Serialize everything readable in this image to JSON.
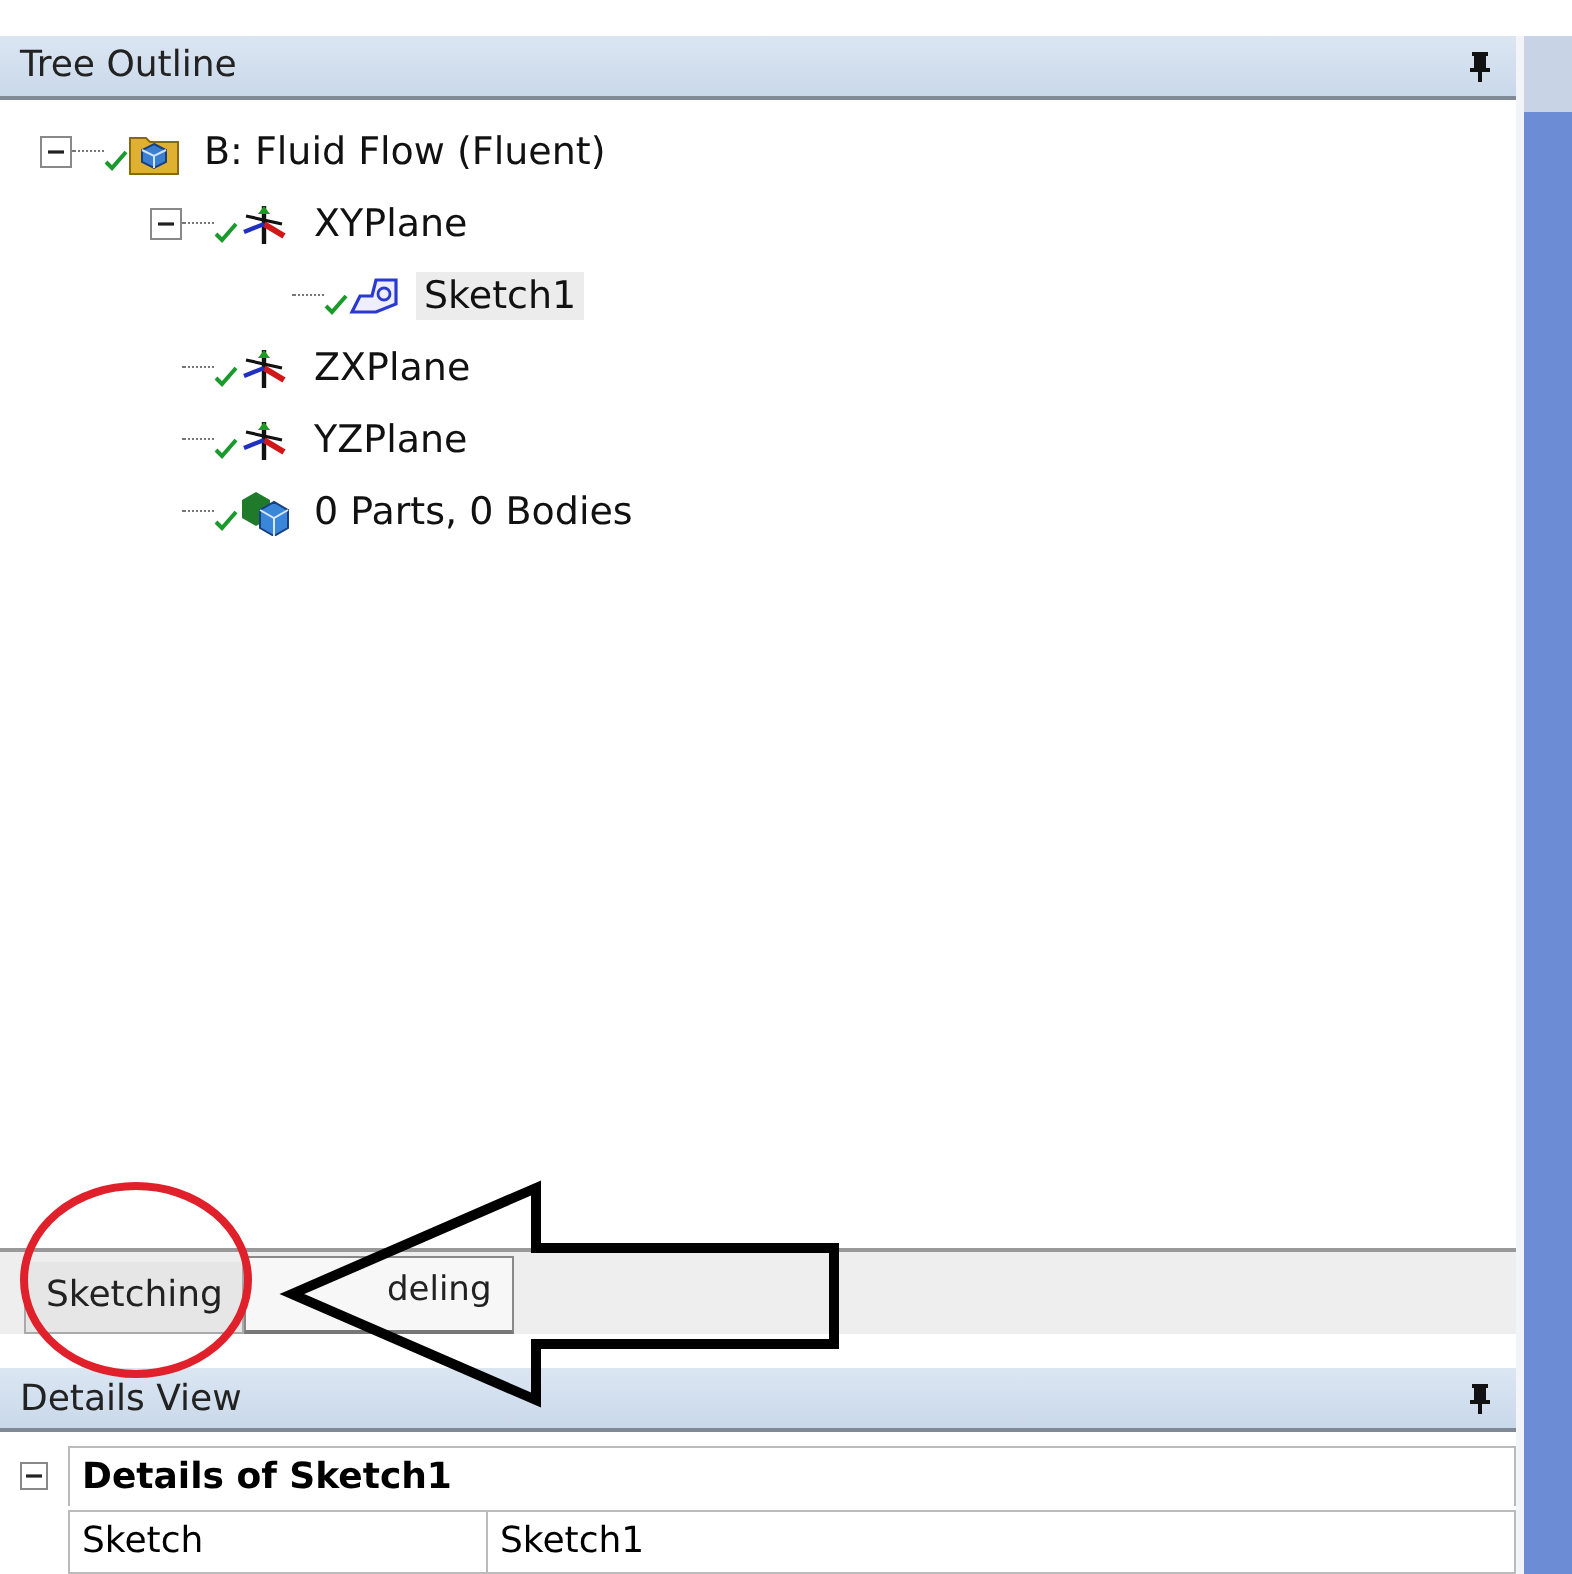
{
  "tree_outline": {
    "title": "Tree Outline",
    "items": [
      {
        "label": "B: Fluid Flow (Fluent)",
        "kind": "geometry",
        "expanded": true,
        "selected": false,
        "children": [
          {
            "label": "XYPlane",
            "kind": "plane",
            "expanded": true,
            "selected": false,
            "children": [
              {
                "label": "Sketch1",
                "kind": "sketch",
                "selected": true
              }
            ]
          },
          {
            "label": "ZXPlane",
            "kind": "plane",
            "selected": false
          },
          {
            "label": "YZPlane",
            "kind": "plane",
            "selected": false
          },
          {
            "label": "0 Parts, 0 Bodies",
            "kind": "bodies",
            "selected": false
          }
        ]
      }
    ]
  },
  "tabs": [
    {
      "label": "Sketching",
      "selected": false
    },
    {
      "label": "deling",
      "selected": true
    }
  ],
  "details_view": {
    "title": "Details View",
    "group": {
      "title": "Details of Sketch1",
      "expanded": true,
      "rows": [
        {
          "property": "Sketch",
          "value": "Sketch1"
        }
      ]
    }
  }
}
